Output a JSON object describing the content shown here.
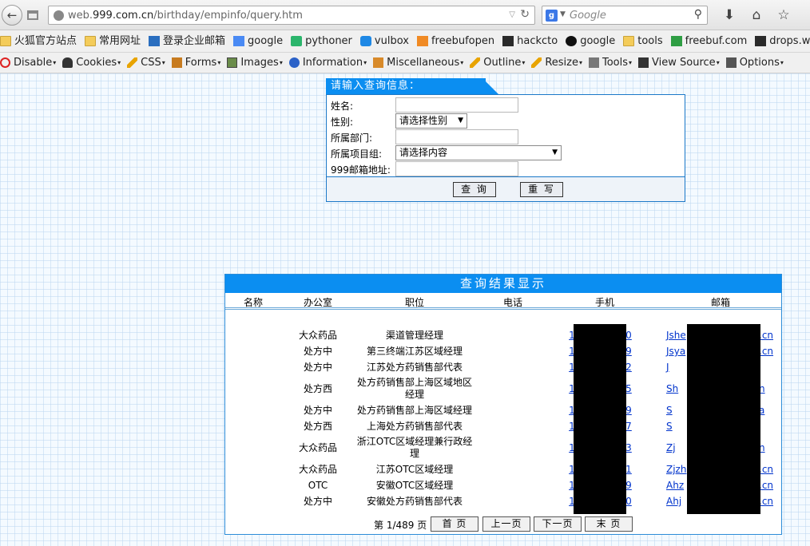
{
  "browser": {
    "url_prefix": "web.",
    "url_domain": "999.com.cn",
    "url_path": "/birthday/empinfo/query.htm",
    "search_placeholder": "Google",
    "search_engine_badge": "g",
    "icons": [
      "back-arrow-icon",
      "tabs-icon",
      "globe-icon",
      "reload-icon",
      "search-icon",
      "download-icon",
      "home-icon",
      "star-icon",
      "menu-icon"
    ]
  },
  "bookmarks": [
    {
      "label": "火狐官方站点",
      "icon": "folder-icon"
    },
    {
      "label": "常用网址",
      "icon": "folder-icon"
    },
    {
      "label": "登录企业邮箱",
      "icon": "mail-icon"
    },
    {
      "label": "google",
      "icon": "google-icon"
    },
    {
      "label": "pythoner",
      "icon": "python-icon"
    },
    {
      "label": "vulbox",
      "icon": "hexagon-icon"
    },
    {
      "label": "freebufopen",
      "icon": "freebuf-icon"
    },
    {
      "label": "hackcto",
      "icon": "hackcto-icon"
    },
    {
      "label": "google",
      "icon": "github-icon"
    },
    {
      "label": "tools",
      "icon": "folder-icon"
    },
    {
      "label": "freebuf.com",
      "icon": "freebuf-green-icon"
    },
    {
      "label": "drops.wooyun.org",
      "icon": "wooyun-icon"
    }
  ],
  "devtools": [
    {
      "label": "Disable",
      "icon": "stop-icon"
    },
    {
      "label": "Cookies",
      "icon": "person-icon"
    },
    {
      "label": "CSS",
      "icon": "pencil-icon"
    },
    {
      "label": "Forms",
      "icon": "clipboard-icon"
    },
    {
      "label": "Images",
      "icon": "image-icon"
    },
    {
      "label": "Information",
      "icon": "info-icon"
    },
    {
      "label": "Miscellaneous",
      "icon": "misc-icon"
    },
    {
      "label": "Outline",
      "icon": "outline-icon"
    },
    {
      "label": "Resize",
      "icon": "resize-icon"
    },
    {
      "label": "Tools",
      "icon": "tools-icon"
    },
    {
      "label": "View Source",
      "icon": "source-icon"
    },
    {
      "label": "Options",
      "icon": "options-icon"
    }
  ],
  "query": {
    "title": "请输入查询信息：",
    "fields": [
      {
        "label": "姓名:",
        "type": "text",
        "value": ""
      },
      {
        "label": "性别:",
        "type": "select",
        "value": "请选择性别"
      },
      {
        "label": "所属部门:",
        "type": "text",
        "value": ""
      },
      {
        "label": "所属项目组:",
        "type": "select",
        "value": "请选择内容"
      },
      {
        "label": "999邮箱地址:",
        "type": "text",
        "value": ""
      }
    ],
    "submit_label": "查 询",
    "reset_label": "重 写"
  },
  "results": {
    "title": "查询结果显示",
    "columns": [
      "名称",
      "办公室",
      "职位",
      "电话",
      "手机",
      "邮箱"
    ],
    "rows": [
      {
        "office": "大众药品",
        "position": "渠道管理经理",
        "mobile_start": "1",
        "mobile_end": "0",
        "email_start": "Jshe",
        "email_end": ".cn"
      },
      {
        "office": "处方中",
        "position": "第三终端江苏区域经理",
        "mobile_start": "1",
        "mobile_end": "9",
        "email_start": "Jsya",
        "email_end": ".cn"
      },
      {
        "office": "处方中",
        "position": "江苏处方药销售部代表",
        "mobile_start": "1",
        "mobile_end": "2",
        "email_start": "J",
        "email_end": ""
      },
      {
        "office": "处方西",
        "position": "处方药销售部上海区域地区经理",
        "mobile_start": "1",
        "mobile_end": "5",
        "email_start": "Sh",
        "email_end": "n"
      },
      {
        "office": "处方中",
        "position": "处方药销售部上海区域经理",
        "mobile_start": "1",
        "mobile_end": "9",
        "email_start": "S",
        "email_end": "a"
      },
      {
        "office": "处方西",
        "position": "上海处方药销售部代表",
        "mobile_start": "1",
        "mobile_end": "7",
        "email_start": "S",
        "email_end": ""
      },
      {
        "office": "大众药品",
        "position": "浙江OTC区域经理兼行政经理",
        "mobile_start": "1",
        "mobile_end": "3",
        "email_start": "Zj",
        "email_end": "n"
      },
      {
        "office": "大众药品",
        "position": "江苏OTC区域经理",
        "mobile_start": "1",
        "mobile_end": "1",
        "email_start": "Zjzh",
        "email_end": ".cn"
      },
      {
        "office": "OTC",
        "position": "安徽OTC区域经理",
        "mobile_start": "1",
        "mobile_end": "9",
        "email_start": "Ahz",
        "email_end": ".cn"
      },
      {
        "office": "处方中",
        "position": "安徽处方药销售部代表",
        "mobile_start": "1",
        "mobile_end": "0",
        "email_start": "Ahj",
        "email_end": ".cn"
      }
    ],
    "pager": {
      "text": "第 1/489 页",
      "first": "首 页",
      "prev": "上一页",
      "next": "下一页",
      "last": "末 页"
    }
  }
}
